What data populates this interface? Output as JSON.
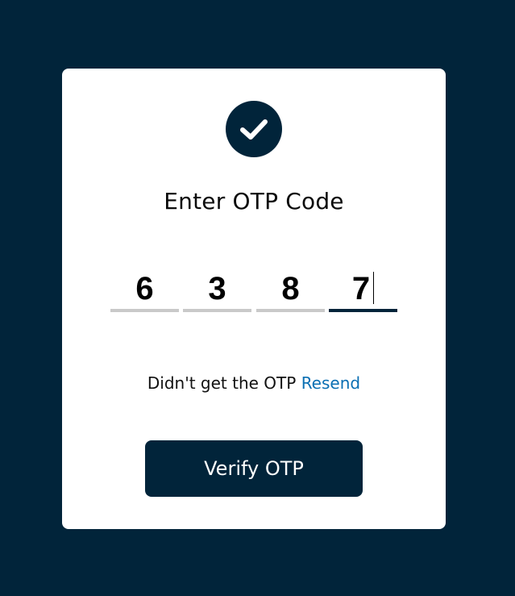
{
  "card": {
    "icon": "check-circle-icon",
    "title": "Enter OTP Code"
  },
  "otp": {
    "digits": [
      "6",
      "3",
      "8",
      "7"
    ],
    "active_index": 3
  },
  "resend": {
    "prompt": "Didn't get the OTP",
    "link_label": "Resend"
  },
  "verify_button": {
    "label": "Verify OTP"
  },
  "colors": {
    "background": "#01243a",
    "card": "#ffffff",
    "accent": "#01243a",
    "link": "#0a6fb3",
    "inactive_underline": "#c9c9c9"
  }
}
